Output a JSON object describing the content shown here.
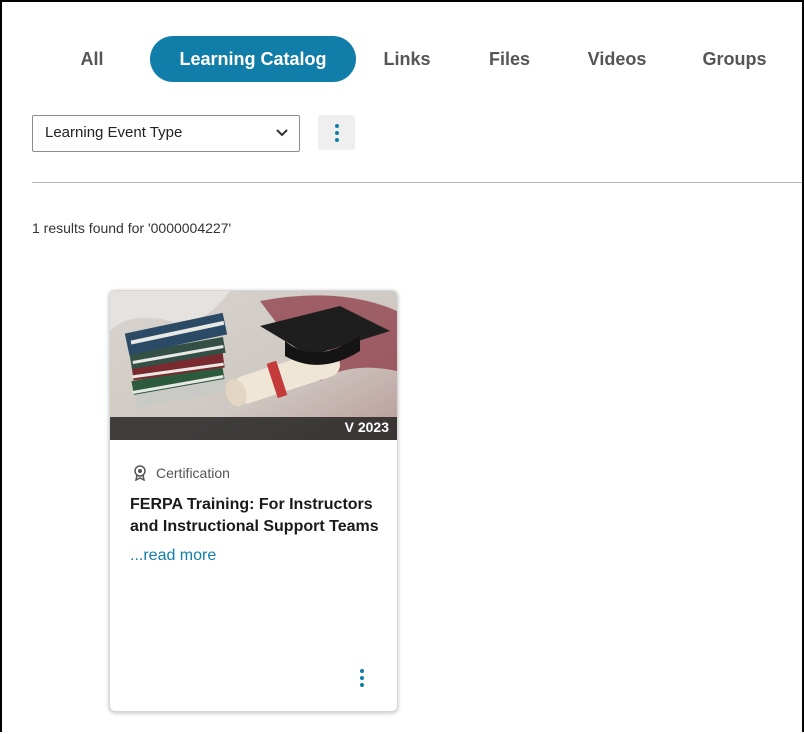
{
  "tabs": [
    {
      "label": "All",
      "active": false
    },
    {
      "label": "Learning Catalog",
      "active": true
    },
    {
      "label": "Links",
      "active": false
    },
    {
      "label": "Files",
      "active": false
    },
    {
      "label": "Videos",
      "active": false
    },
    {
      "label": "Groups",
      "active": false
    }
  ],
  "filter": {
    "selected": "Learning Event Type"
  },
  "results": {
    "summary": "1 results found for '0000004227'"
  },
  "card": {
    "version": "V 2023",
    "type": "Certification",
    "title": "FERPA Training: For Instructors and Instructional Support Teams",
    "read_more": "...read more"
  },
  "colors": {
    "accent": "#107ea8",
    "tab_text": "#555555",
    "divider": "#b7b7b7"
  },
  "icons": {
    "filter_chevron": "chevron-down-icon",
    "more": "kebab-menu-icon",
    "certification": "certificate-ribbon-icon"
  }
}
